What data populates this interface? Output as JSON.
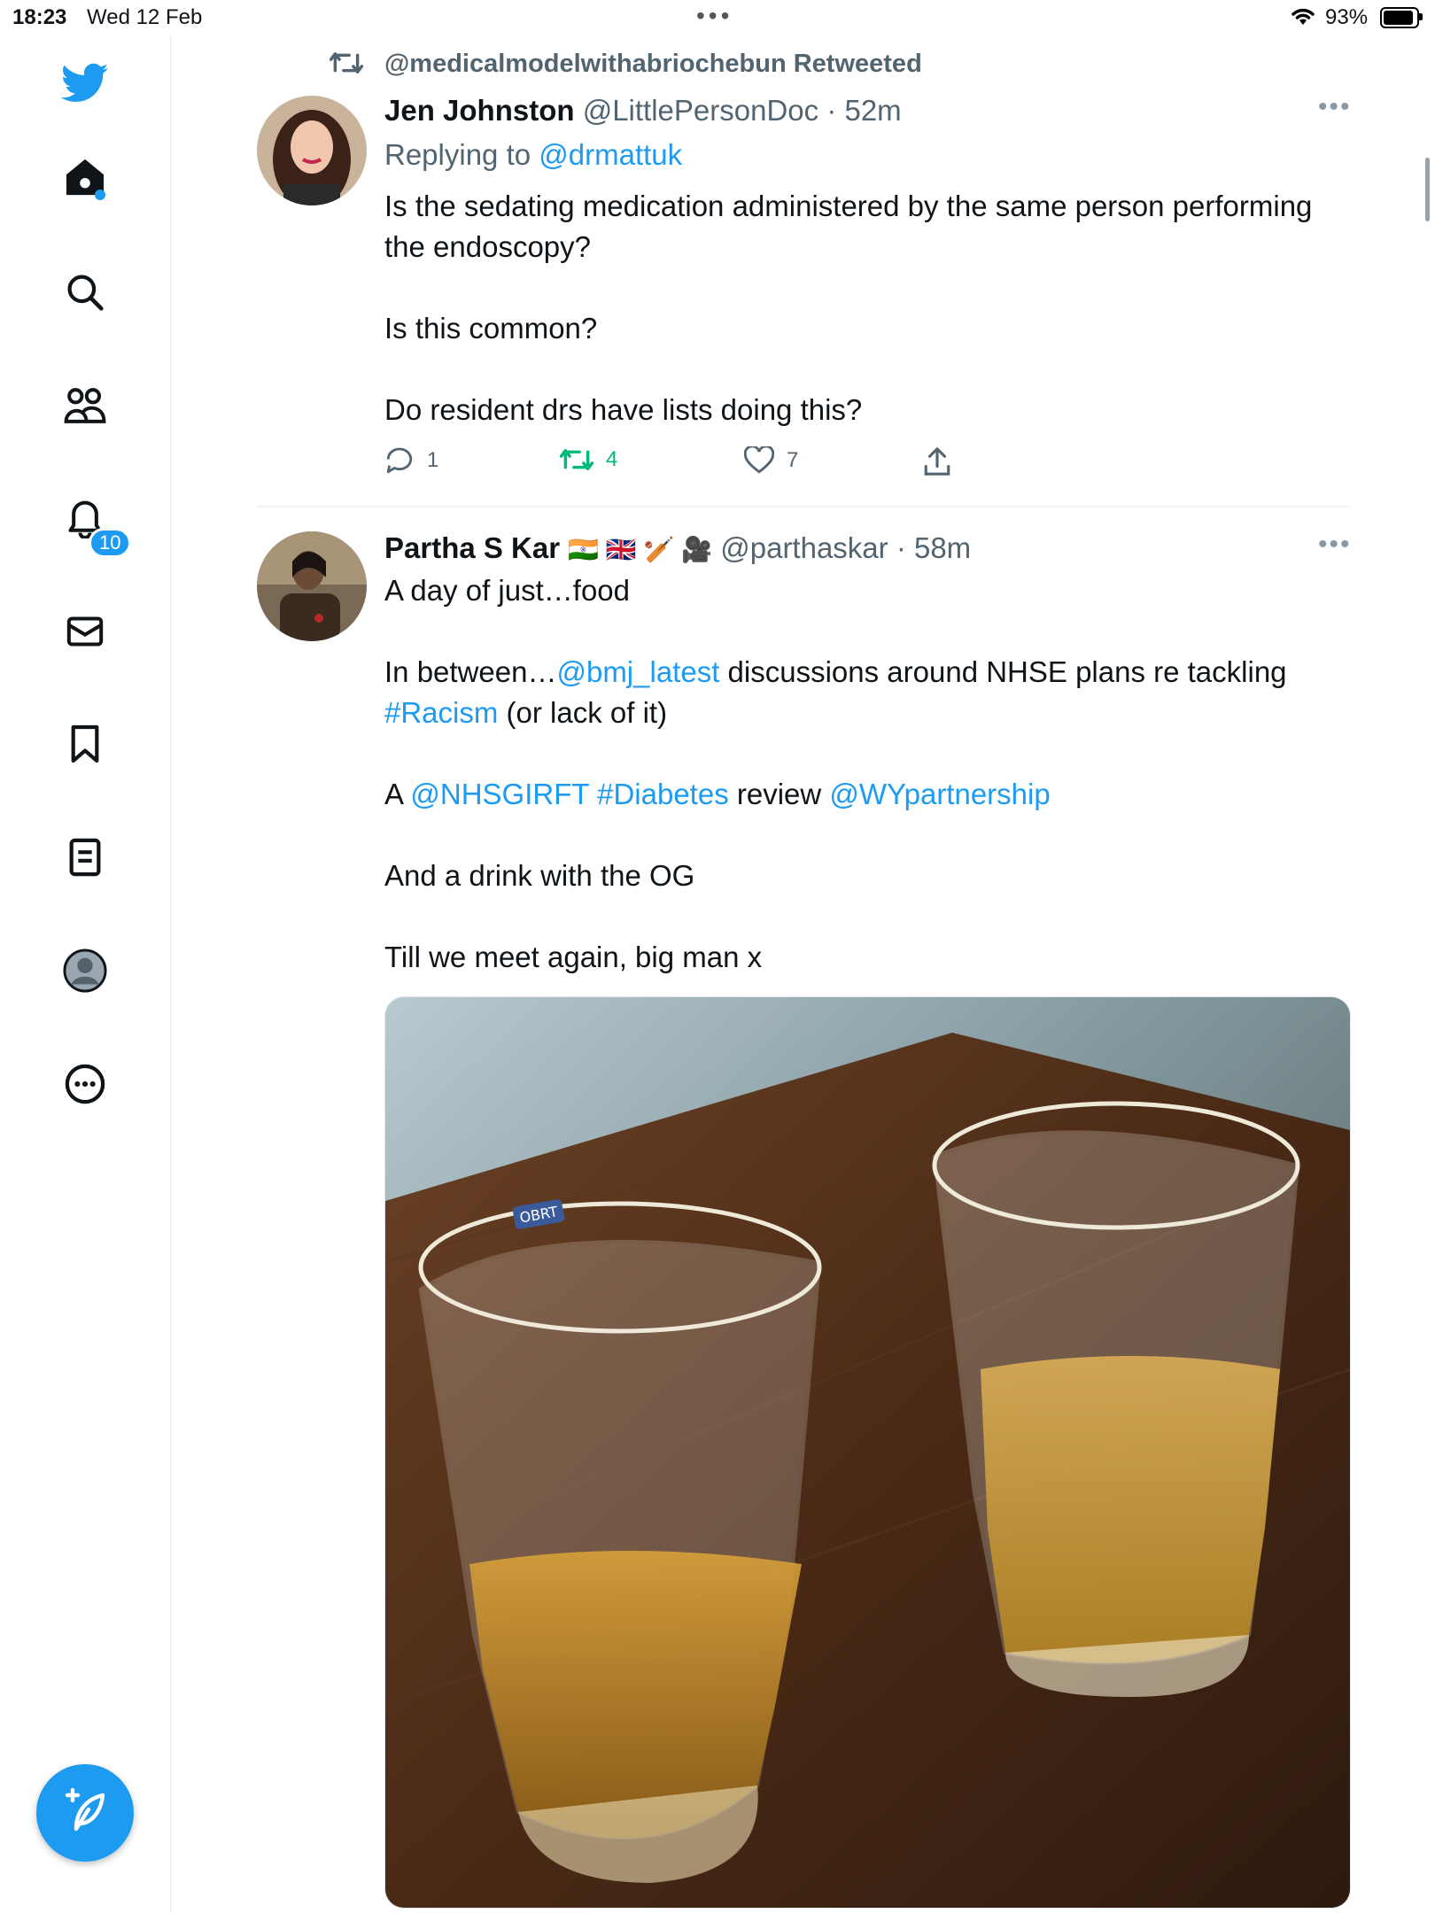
{
  "status_bar": {
    "time": "18:23",
    "date": "Wed 12 Feb",
    "battery": "93%",
    "battery_level": 0.93
  },
  "sidebar": {
    "notifications_badge": "10"
  },
  "feed": {
    "tweet1": {
      "retweet_context": "@medicalmodelwithabriochebun Retweeted",
      "author_name": "Jen Johnston",
      "handle_time": "@LittlePersonDoc · 52m",
      "replying_prefix": "Replying to",
      "replying_handle": "@drmattuk",
      "line1": "Is the sedating medication administered by the same person performing",
      "line2": "the endoscopy?",
      "line3": "Is this common?",
      "line4": "Do resident drs have lists doing this?",
      "replies": "1",
      "retweets": "4",
      "likes": "7"
    },
    "tweet2": {
      "author_name": "Partha S Kar",
      "emojis": "🇮🇳 🇬🇧 🏏 🎥",
      "handle_time": "@parthaskar · 58m",
      "line1": "A day of just…food",
      "p2_a": "In between…",
      "p2_mention": "@bmj_latest",
      "p2_b": " discussions around NHSE plans re tackling",
      "p2_tag": "#Racism",
      "p2_c": " (or lack of it)",
      "p3_a": "A ",
      "p3_mention1": "@NHSGIRFT",
      "p3_tag": "#Diabetes",
      "p3_b": " review ",
      "p3_mention2": "@WYpartnership",
      "p4": "And a drink with the OG",
      "p5": "Till we meet again, big man x",
      "glass_label": "OBRT"
    }
  }
}
